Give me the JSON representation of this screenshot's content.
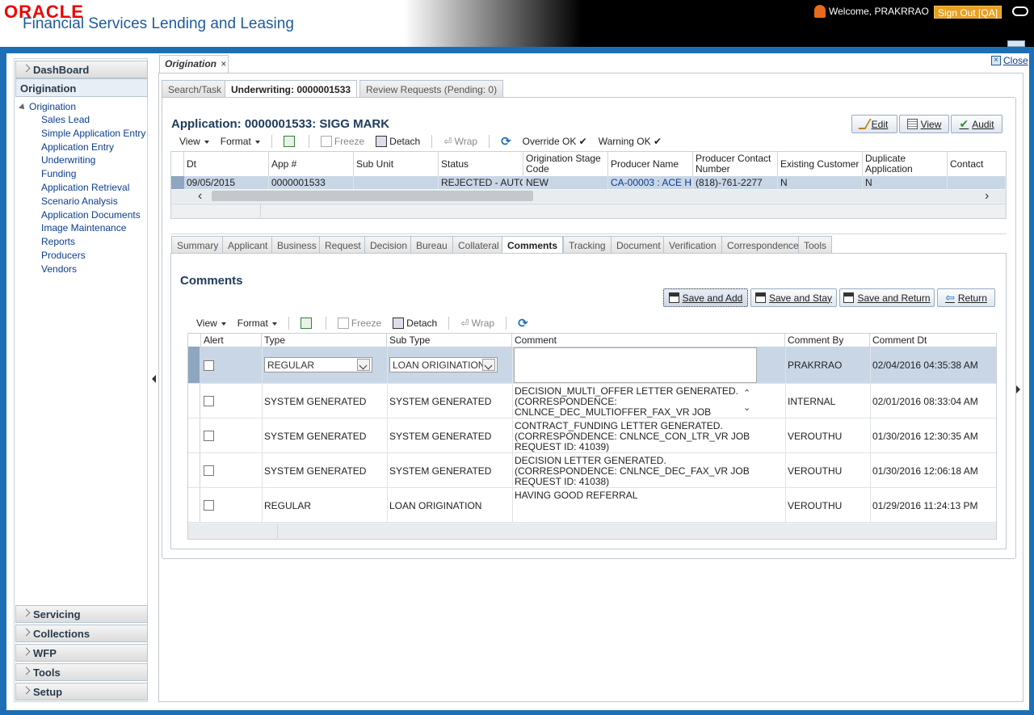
{
  "header": {
    "logo": "ORACLE",
    "app_name": "Financial Services Lending and Leasing",
    "welcome": "Welcome, PRAKRRAO",
    "sign_out": "Sign Out [QA]"
  },
  "sidebar": {
    "top_sections": [
      "DashBoard"
    ],
    "active_section": "Origination",
    "tree_root": "Origination",
    "items": [
      "Sales Lead",
      "Simple Application Entry",
      "Application Entry",
      "Underwriting",
      "Funding",
      "Application Retrieval",
      "Scenario Analysis",
      "Application Documents",
      "Image Maintenance",
      "Reports",
      "Producers",
      "Vendors"
    ],
    "bottom_sections": [
      "Servicing",
      "Collections",
      "WFP",
      "Tools",
      "Setup"
    ]
  },
  "main_tab": {
    "label": "Origination",
    "close_x": "×",
    "close_link": "Close"
  },
  "sub_tabs": [
    "Search/Task",
    "Underwriting: 0000001533",
    "Review Requests (Pending: 0)"
  ],
  "application": {
    "title": "Application: 0000001533: SIGG MARK",
    "actions": [
      "Edit",
      "View",
      "Audit"
    ]
  },
  "toolbar1": {
    "view": "View",
    "format": "Format",
    "freeze": "Freeze",
    "detach": "Detach",
    "wrap": "Wrap",
    "override_ok": "Override OK ✔",
    "warning_ok": "Warning OK ✔"
  },
  "app_grid": {
    "columns": [
      "Dt",
      "App #",
      "Sub Unit",
      "Status",
      "Origination Stage Code",
      "Producer Name",
      "Producer Contact Number",
      "Existing Customer",
      "Duplicate Application",
      "Contact"
    ],
    "row": [
      "09/05/2015",
      "0000001533",
      "",
      "REJECTED - AUTO...",
      "NEW",
      "CA-00003 : ACE H...",
      "(818)-761-2277",
      "N",
      "N",
      ""
    ]
  },
  "detail_tabs": [
    "Summary",
    "Applicant",
    "Business",
    "Request",
    "Decision",
    "Bureau",
    "Collateral",
    "Comments",
    "Tracking",
    "Document",
    "Verification",
    "Correspondence",
    "Tools"
  ],
  "comments": {
    "title": "Comments",
    "buttons": [
      "Save and Add",
      "Save and Stay",
      "Save and Return",
      "Return"
    ],
    "toolbar": {
      "view": "View",
      "format": "Format",
      "freeze": "Freeze",
      "detach": "Detach",
      "wrap": "Wrap"
    },
    "columns": [
      "Alert",
      "Type",
      "Sub Type",
      "Comment",
      "Comment By",
      "Comment Dt"
    ],
    "edit_row": {
      "type": "REGULAR",
      "sub_type": "LOAN ORIGINATION",
      "comment": "",
      "by": "PRAKRRAO",
      "dt": "02/04/2016 04:35:38 AM"
    },
    "rows": [
      {
        "type": "SYSTEM GENERATED",
        "sub_type": "SYSTEM GENERATED",
        "comment": "DECISION_MULTI_OFFER LETTER  GENERATED. (CORRESPONDENCE: CNLNCE_DEC_MULTIOFFER_FAX_VR JOB REQUEST ID:",
        "by": "INTERNAL",
        "dt": "02/01/2016 08:33:04 AM"
      },
      {
        "type": "SYSTEM GENERATED",
        "sub_type": "SYSTEM GENERATED",
        "comment": "CONTRACT_FUNDING LETTER  GENERATED. (CORRESPONDENCE: CNLNCE_CON_LTR_VR JOB REQUEST ID: 41039)",
        "by": "VEROUTHU",
        "dt": "01/30/2016 12:30:35 AM"
      },
      {
        "type": "SYSTEM GENERATED",
        "sub_type": "SYSTEM GENERATED",
        "comment": "DECISION LETTER  GENERATED. (CORRESPONDENCE: CNLNCE_DEC_FAX_VR JOB REQUEST ID: 41038)",
        "by": "VEROUTHU",
        "dt": "01/30/2016 12:06:18 AM"
      },
      {
        "type": "REGULAR",
        "sub_type": "LOAN ORIGINATION",
        "comment": "HAVING GOOD REFERRAL",
        "by": "VEROUTHU",
        "dt": "01/29/2016 11:24:13 PM"
      }
    ]
  }
}
